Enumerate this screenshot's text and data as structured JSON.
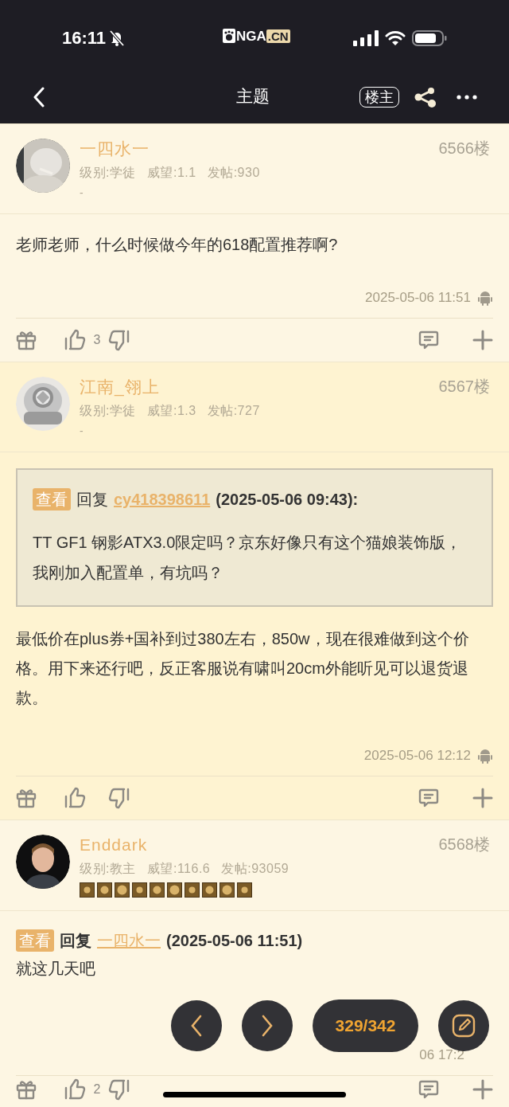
{
  "status_bar": {
    "time": "16:11",
    "logo_main": "NGA",
    "logo_suffix": ".CN"
  },
  "nav_bar": {
    "title": "主题",
    "author_filter": "楼主"
  },
  "posts": [
    {
      "shaded": false,
      "username": "一四水一",
      "floor": "6566楼",
      "level": "级别:学徒",
      "prestige": "威望:1.1",
      "post_count": "发帖:930",
      "signature": "-",
      "body": "老师老师，什么时候做今年的618配置推荐啊?",
      "timestamp": "2025-05-06 11:51",
      "likes": "3"
    },
    {
      "shaded": true,
      "username": "江南_翎上",
      "floor": "6567楼",
      "level": "级别:学徒",
      "prestige": "威望:1.3",
      "post_count": "发帖:727",
      "signature": "-",
      "reply": {
        "kind": "boxed",
        "tag": "查看",
        "label": "回复",
        "author": "cy418398611",
        "time": "(2025-05-06 09:43):",
        "text": "TT GF1 钢影ATX3.0限定吗？京东好像只有这个猫娘装饰版，我刚加入配置单，有坑吗？"
      },
      "body": "最低价在plus券+国补到过380左右，850w，现在很难做到这个价格。用下来还行吧，反正客服说有啸叫20cm外能听见可以退货退款。",
      "timestamp": "2025-05-06 12:12"
    },
    {
      "shaded": false,
      "username": "Enddark",
      "floor": "6568楼",
      "level": "级别:教主",
      "prestige": "威望:116.6",
      "post_count": "发帖:93059",
      "badges": true,
      "reply": {
        "kind": "inline",
        "tag": "查看",
        "label": "回复",
        "author": "一四水一",
        "time": "(2025-05-06 11:51)"
      },
      "body": "就这几天吧",
      "timestamp": "06 17:2",
      "likes": "2"
    }
  ],
  "pager": {
    "page": "329/342"
  }
}
